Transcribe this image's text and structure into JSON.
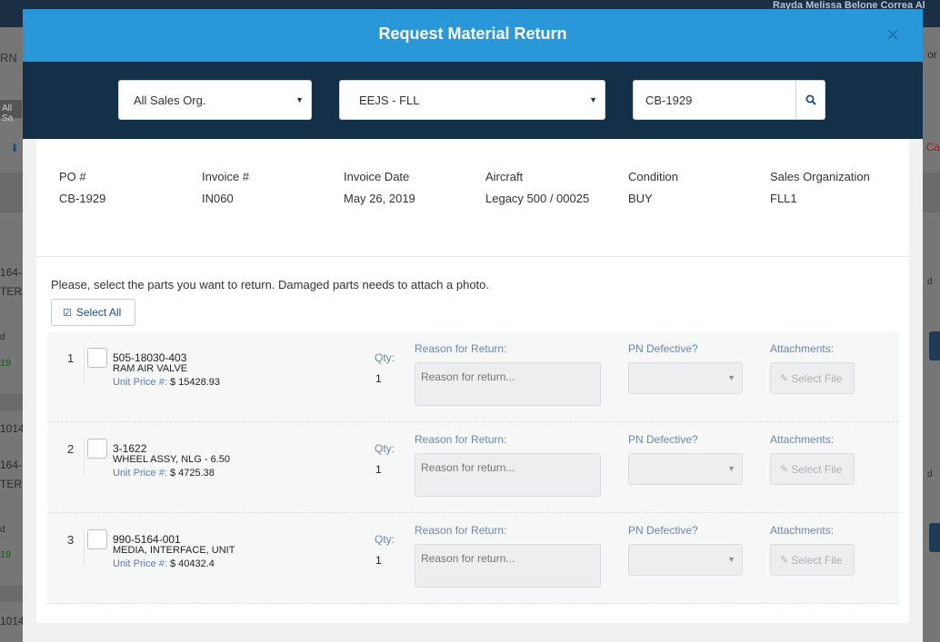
{
  "background": {
    "user_name": "Rayda Melissa Belone Correa Al",
    "frag_rn": "RN",
    "frag_all_sa": "All Sa",
    "frag_or": "or",
    "frag_ca": "Ca",
    "frag_164_a": "164-",
    "frag_ter_a": "TER",
    "frag_19_a": "19",
    "frag_1014_a": "1014",
    "frag_164_b": "164-",
    "frag_ter_b": "TER",
    "frag_19_b": "19",
    "frag_1014_b": "1014",
    "frag_d_a": "d",
    "frag_d_b": "d",
    "frag_d_c": "d",
    "frag_d_d": "d"
  },
  "modal": {
    "title": "Request Material Return",
    "close_glyph": "×",
    "filters": {
      "sales_org": "All Sales Org.",
      "location": "EEJS - FLL",
      "search_value": "CB-1929"
    },
    "info": [
      {
        "label": "PO #",
        "value": "CB-1929"
      },
      {
        "label": "Invoice #",
        "value": "IN060"
      },
      {
        "label": "Invoice Date",
        "value": "May 26, 2019"
      },
      {
        "label": "Aircraft",
        "value": "Legacy 500 / 00025"
      },
      {
        "label": "Condition",
        "value": "BUY"
      },
      {
        "label": "Sales Organization",
        "value": "FLL1"
      }
    ],
    "instructions": "Please, select the parts you want to return. Damaged parts needs to attach a photo.",
    "select_all_label": "Select All",
    "row_labels": {
      "qty": "Qty:",
      "reason": "Reason for Return:",
      "reason_placeholder": "Reason for return...",
      "defective": "PN Defective?",
      "attachments": "Attachments:",
      "select_file": "Select File",
      "unit_price": "Unit Price #:"
    },
    "parts": [
      {
        "index": "1",
        "part_number": "505-18030-403",
        "description": "RAM AIR VALVE",
        "unit_price": "$ 15428.93",
        "qty": "1"
      },
      {
        "index": "2",
        "part_number": "3-1622",
        "description": "WHEEL ASSY, NLG - 6.50",
        "unit_price": "$ 4725.38",
        "qty": "1"
      },
      {
        "index": "3",
        "part_number": "990-5164-001",
        "description": "MEDIA, INTERFACE, UNIT",
        "unit_price": "$ 40432.4",
        "qty": "1"
      }
    ]
  },
  "colors": {
    "header_blue": "#2a97d8",
    "filter_bar_navy": "#143049",
    "label_blue": "#6d86a8"
  }
}
